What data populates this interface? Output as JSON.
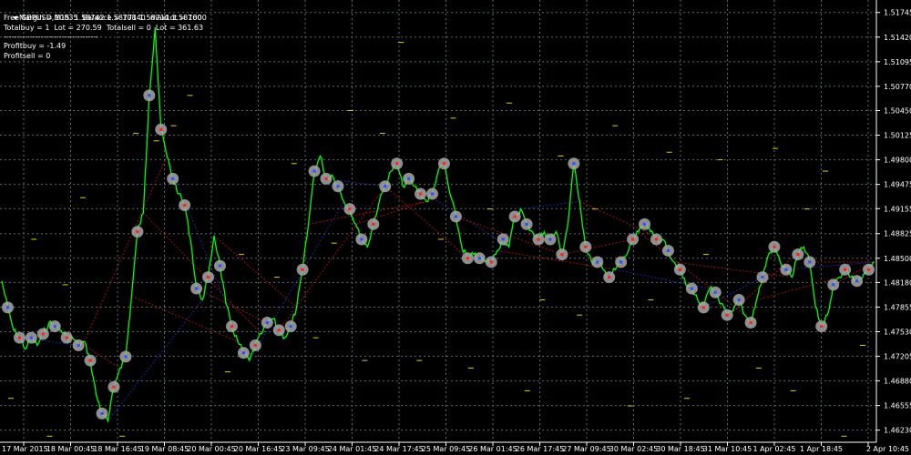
{
  "header": {
    "symbol_ohlc": "GBPUSD,M15  1.58742 1.58771 1.58710 1.58760",
    "account_line": "FreeMargin = 10835  Balance = 10840  maxLot = 1000",
    "totals_line": "Totalbuy = 1  Lot = 270.59  Totalsell = 0  Lot = 361.63",
    "separator": "------------------------------------",
    "profit_buy": "Profitbuy = -1.49",
    "profit_sell": "Profitsell = 0"
  },
  "colors": {
    "background": "#000000",
    "grid": "#5a6b6b",
    "price_line": "#00ff00",
    "buy_line": "#1e2fd0",
    "sell_line": "#cc1010",
    "marker_halo": "#a7a7a7",
    "level_marks": "#e0d000",
    "axis_text": "#ffffff"
  },
  "chart_data": {
    "type": "line",
    "series": [
      {
        "values": [
          1.482,
          1.4785,
          1.4755,
          1.4745,
          1.473,
          1.4745,
          1.4735,
          1.475,
          1.4765,
          1.476,
          1.4755,
          1.4745,
          1.4745,
          1.4735,
          1.474,
          1.4715,
          1.467,
          1.4645,
          1.4635,
          1.468,
          1.4705,
          1.472,
          1.48,
          1.4885,
          1.491,
          1.5065,
          1.5155,
          1.502,
          1.4985,
          1.4955,
          1.4935,
          1.492,
          1.4875,
          1.481,
          1.4795,
          1.4825,
          1.488,
          1.484,
          1.479,
          1.476,
          1.474,
          1.4725,
          1.4715,
          1.4735,
          1.475,
          1.4765,
          1.477,
          1.4755,
          1.4745,
          1.476,
          1.4785,
          1.4835,
          1.4895,
          1.4965,
          1.4985,
          1.4955,
          1.496,
          1.4945,
          1.4925,
          1.4915,
          1.4895,
          1.4875,
          1.4865,
          1.4895,
          1.4925,
          1.4945,
          1.4965,
          1.4975,
          1.4945,
          1.4955,
          1.4945,
          1.4935,
          1.4925,
          1.4935,
          1.4965,
          1.4975,
          1.4935,
          1.4905,
          1.4865,
          1.485,
          1.4855,
          1.485,
          1.4845,
          1.4845,
          1.486,
          1.4875,
          1.4865,
          1.4905,
          1.4915,
          1.4895,
          1.4885,
          1.4875,
          1.4885,
          1.4875,
          1.4885,
          1.4855,
          1.4895,
          1.4975,
          1.4925,
          1.4865,
          1.4845,
          1.4845,
          1.4835,
          1.4825,
          1.4835,
          1.4845,
          1.4855,
          1.4875,
          1.4885,
          1.4895,
          1.4885,
          1.4875,
          1.4875,
          1.486,
          1.4845,
          1.4835,
          1.4815,
          1.481,
          1.4795,
          1.4785,
          1.481,
          1.4805,
          1.479,
          1.4775,
          1.478,
          1.4795,
          1.4775,
          1.4765,
          1.4795,
          1.4825,
          1.4855,
          1.4865,
          1.4845,
          1.4835,
          1.4825,
          1.4855,
          1.4865,
          1.4845,
          1.4785,
          1.476,
          1.4775,
          1.4815,
          1.4825,
          1.4835,
          1.4825,
          1.482,
          1.4825,
          1.4835,
          1.4845
        ]
      }
    ],
    "y_ticks": [
      "1.51745",
      "1.51420",
      "1.51095",
      "1.50770",
      "1.50450",
      "1.50125",
      "1.49800",
      "1.49475",
      "1.49155",
      "1.48825",
      "1.48500",
      "1.48180",
      "1.47855",
      "1.47530",
      "1.47205",
      "1.46880",
      "1.46555",
      "1.46230"
    ],
    "x_ticks": [
      "17 Mar 2015",
      "18 Mar 00:45",
      "18 Mar 16:45",
      "19 Mar 08:45",
      "20 Mar 00:45",
      "20 Mar 16:45",
      "23 Mar 09:45",
      "24 Mar 01:45",
      "24 Mar 17:45",
      "25 Mar 09:45",
      "26 Mar 01:45",
      "26 Mar 17:45",
      "27 Mar 09:45",
      "30 Mar 02:45",
      "30 Mar 18:45",
      "31 Mar 10:45",
      "1 Apr 02:45",
      "1 Apr 18:45",
      "2 Apr 10:45"
    ],
    "ylim": [
      1.4607,
      1.5191
    ],
    "grid": true
  }
}
